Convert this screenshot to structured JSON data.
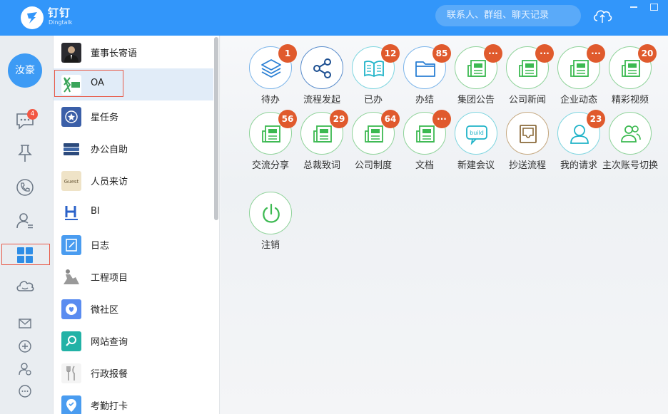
{
  "titlebar": {
    "app_name": "钉钉",
    "app_sub": "Dingtalk",
    "search_placeholder": "联系人、群组、聊天记录"
  },
  "rail": {
    "avatar_text": "汝豪",
    "chat_badge": "4"
  },
  "list": {
    "items": [
      {
        "label": "董事长寄语",
        "icon": "chairman-photo-icon"
      },
      {
        "label": "OA",
        "icon": "oa-logo-icon"
      },
      {
        "label": "星任务",
        "icon": "star-task-icon"
      },
      {
        "label": "办公自助",
        "icon": "books-icon"
      },
      {
        "label": "人员来访",
        "icon": "guest-card-icon",
        "icon_text": "Guest"
      },
      {
        "label": "BI",
        "icon": "bi-logo-icon"
      },
      {
        "label": "日志",
        "icon": "log-icon"
      },
      {
        "label": "工程项目",
        "icon": "construction-icon"
      },
      {
        "label": "微社区",
        "icon": "community-icon"
      },
      {
        "label": "网站查询",
        "icon": "web-search-icon"
      },
      {
        "label": "行政报餐",
        "icon": "meal-icon"
      },
      {
        "label": "考勤打卡",
        "icon": "attendance-icon"
      }
    ]
  },
  "apps": [
    {
      "label": "待办",
      "badge": "1",
      "icon": "layers-icon"
    },
    {
      "label": "流程发起",
      "badge": "",
      "icon": "share-icon"
    },
    {
      "label": "已办",
      "badge": "12",
      "icon": "open-book-icon"
    },
    {
      "label": "办结",
      "badge": "85",
      "icon": "folder-icon"
    },
    {
      "label": "集团公告",
      "badge": "···",
      "icon": "newspaper-icon"
    },
    {
      "label": "公司新闻",
      "badge": "···",
      "icon": "newspaper-icon"
    },
    {
      "label": "企业动态",
      "badge": "···",
      "icon": "newspaper-icon"
    },
    {
      "label": "精彩视频",
      "badge": "20",
      "icon": "newspaper-icon"
    },
    {
      "label": "交流分享",
      "badge": "56",
      "icon": "newspaper-icon"
    },
    {
      "label": "总裁致词",
      "badge": "29",
      "icon": "newspaper-icon"
    },
    {
      "label": "公司制度",
      "badge": "64",
      "icon": "newspaper-icon"
    },
    {
      "label": "文档",
      "badge": "···",
      "icon": "newspaper-icon"
    },
    {
      "label": "新建会议",
      "badge": "",
      "icon": "build-bubble-icon",
      "icon_text": "build"
    },
    {
      "label": "抄送流程",
      "badge": "",
      "icon": "inbox-icon"
    },
    {
      "label": "我的请求",
      "badge": "23",
      "icon": "person-icon"
    },
    {
      "label": "主次账号切换",
      "badge": "",
      "icon": "users-icon"
    },
    {
      "label": "注销",
      "badge": "",
      "icon": "power-icon"
    }
  ],
  "colors": {
    "brand_blue": "#3296fa",
    "badge_orange": "#e05a2d",
    "highlight_red": "#e85b4a",
    "icon_blue": "#2a7fd4",
    "icon_green": "#3cb951"
  }
}
